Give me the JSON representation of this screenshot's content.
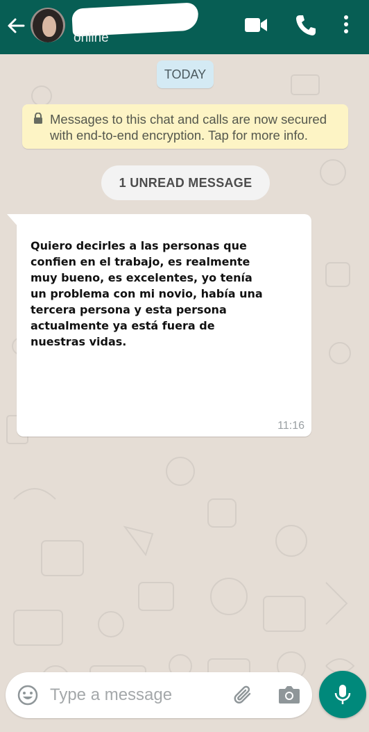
{
  "header": {
    "status": "online",
    "back_icon": "arrow-back-icon",
    "video_icon": "video-camera-icon",
    "call_icon": "phone-icon",
    "menu_icon": "more-vert-icon",
    "color": "#075e54"
  },
  "chat": {
    "date_chip": "TODAY",
    "encryption_notice": "Messages to this chat and calls are now secured with end-to-end encryption. Tap for more info.",
    "unread_label": "1 UNREAD MESSAGE",
    "messages": [
      {
        "text": "Quiero decirles a las personas que confien en el trabajo, es realmente muy bueno, es excelentes, yo tenía un problema con mi novio, había una tercera persona y esta persona actualmente ya está fuera de nuestras vidas.",
        "time": "11:16"
      }
    ]
  },
  "composer": {
    "placeholder": "Type a message",
    "emoji_icon": "emoji-icon",
    "attach_icon": "paperclip-icon",
    "camera_icon": "camera-icon",
    "mic_icon": "microphone-icon",
    "accent": "#00897b"
  }
}
